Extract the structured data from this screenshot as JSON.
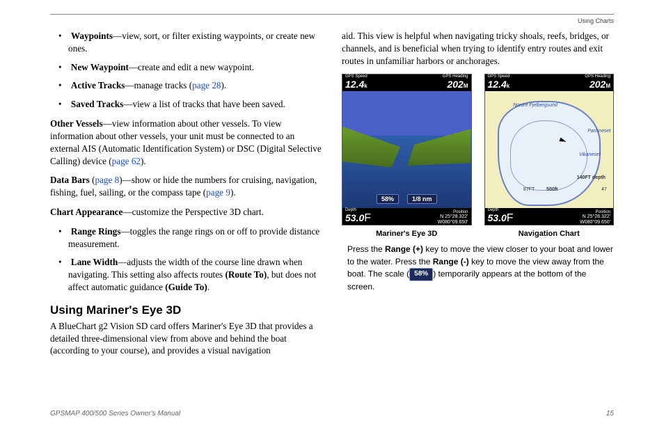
{
  "header": {
    "section_label": "Using Charts"
  },
  "left": {
    "bullets1": [
      {
        "term": "Waypoints",
        "rest": "—view, sort, or filter existing waypoints, or create new ones."
      },
      {
        "term": "New Waypoint",
        "rest": "—create and edit a new waypoint."
      },
      {
        "term": "Active Tracks",
        "rest": "—manage tracks (",
        "link": "page 28",
        "rest2": ")."
      },
      {
        "term": "Saved Tracks",
        "rest": "—view a list of tracks that have been saved."
      }
    ],
    "other_vessels": {
      "term": "Other Vessels",
      "rest": "—view information about other vessels. To view information about other vessels, your unit must be connected to an external AIS (Automatic Identification System) or DSC (Digital Selective Calling) device (",
      "link": "page 62",
      "rest2": ")."
    },
    "data_bars": {
      "term": "Data Bars",
      "pre_link": " (",
      "link1": "page 8",
      "mid": ")—show or hide the numbers for cruising, navigation, fishing, fuel, sailing, or the compass tape (",
      "link2": "page 9",
      "rest2": ")."
    },
    "chart_appearance": {
      "term": "Chart Appearance",
      "rest": "—customize the Perspective 3D chart."
    },
    "bullets2": [
      {
        "term": "Range Rings",
        "rest": "—toggles the range rings on or off to provide distance measurement."
      },
      {
        "term": "Lane Width",
        "rest": "—adjusts the width of the course line drawn when navigating. This setting also affects routes ",
        "bold1": "(Route To)",
        "rest2": ", but does not affect automatic guidance ",
        "bold2": "(Guide To)",
        "rest3": "."
      }
    ],
    "heading": "Using Mariner's Eye 3D",
    "heading_para": "A BlueChart g2 Vision SD card offers Mariner's Eye 3D that provides a detailed three-dimensional view from above and behind the boat (according to your course), and provides a visual navigation"
  },
  "right": {
    "cont_para": "aid. This view is helpful when navigating tricky shoals, reefs, bridges, or channels, and is beneficial when trying to identify entry routes and exit routes in unfamiliar harbors or anchorages.",
    "figures": {
      "left": {
        "top_left_label": "GPS Speed",
        "top_left_val": "12.4",
        "top_left_unit": "k",
        "top_right_label": "GPS Heading",
        "top_right_val": "202",
        "top_right_unit": "M",
        "mid_badge1": "58%",
        "mid_badge2": "1/8 nm",
        "bot_left_label": "Depth",
        "bot_left_val": "53.0",
        "bot_left_unit": "F",
        "bot_right_label": "Position",
        "bot_right_line1": "N  25°28.322'",
        "bot_right_line2": "W080°09.650'",
        "caption": "Mariner's Eye 3D"
      },
      "right": {
        "top_left_label": "GPS Speed",
        "top_left_val": "12.4",
        "top_left_unit": "k",
        "top_right_label": "GPS Heading",
        "top_right_val": "202",
        "top_right_unit": "M",
        "label1": "Nordre Fjelbergsund",
        "label2": "Parisneset",
        "label3": "Vikaneset",
        "depth_label": "140FT depth",
        "depth_87": "87FT",
        "scale": "500ft",
        "num1": "47",
        "bot_left_label": "Depth",
        "bot_left_val": "53.0",
        "bot_left_unit": "F",
        "bot_right_label": "Position",
        "bot_right_line1": "N  25°28.322'",
        "bot_right_line2": "W080°09.650'",
        "caption": "Navigation Chart"
      }
    },
    "range_note": {
      "t1": "Press the ",
      "b1": "Range (+)",
      "t2": " key to move the view closer to your boat and lower to the water. Press the ",
      "b2": "Range (-)",
      "t3": " key to move the view away from the boat. The scale (",
      "badge": "58%",
      "t4": ") temporarily appears at the bottom of the screen."
    }
  },
  "footer": {
    "manual": "GPSMAP 400/500 Series Owner's Manual",
    "page": "15"
  }
}
